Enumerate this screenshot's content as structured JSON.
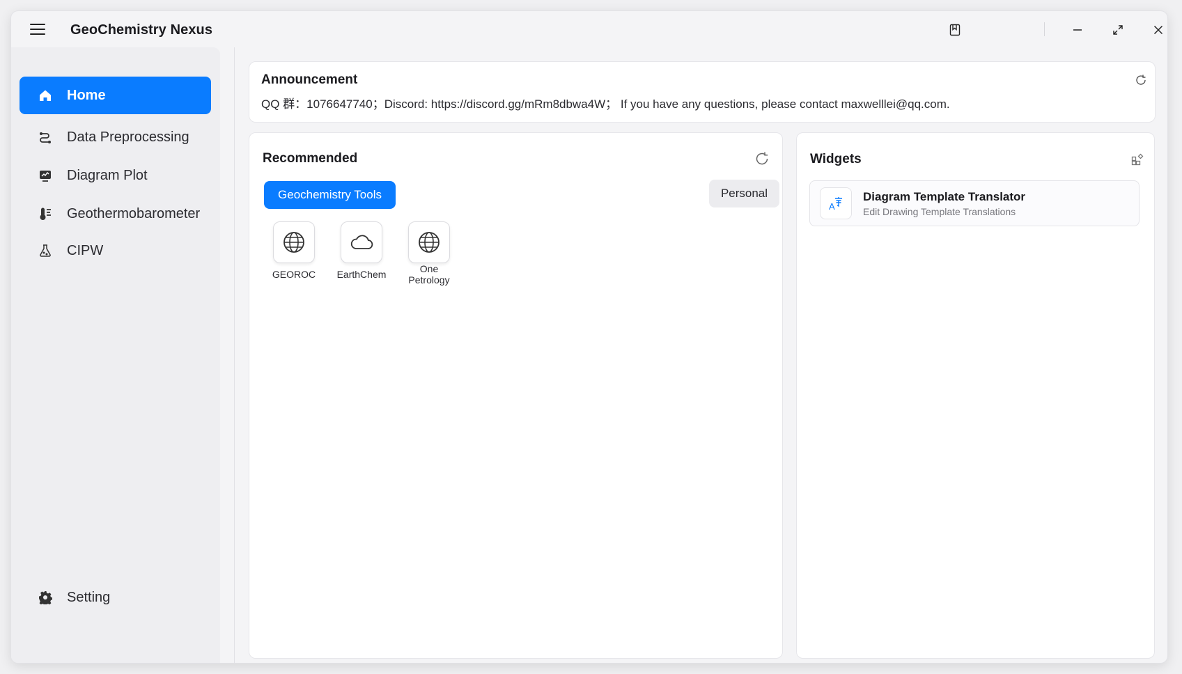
{
  "app": {
    "title": "GeoChemistry Nexus"
  },
  "window_controls": [
    "bookmark-icon",
    "minimize-icon",
    "maximize-icon",
    "close-icon"
  ],
  "sidebar": {
    "items": [
      {
        "label": "Home",
        "icon": "home-icon",
        "active": true
      },
      {
        "label": "Data Preprocessing",
        "icon": "data-preprocessing-icon",
        "active": false
      },
      {
        "label": "Diagram Plot",
        "icon": "diagram-plot-icon",
        "active": false
      },
      {
        "label": "Geothermobarometer",
        "icon": "thermometer-icon",
        "active": false
      },
      {
        "label": "CIPW",
        "icon": "cipw-icon",
        "active": false
      }
    ],
    "settings_label": "Setting"
  },
  "announcement": {
    "title": "Announcement",
    "text": "QQ 群：1076647740；Discord: https://discord.gg/mRm8dbwa4W； If you have any questions, please contact maxwelllei@qq.com."
  },
  "recommended": {
    "title": "Recommended",
    "tabs": [
      {
        "label": "Geochemistry Tools",
        "active": true
      },
      {
        "label": "Personal",
        "active": false
      }
    ],
    "tools": [
      {
        "label": "GEOROC",
        "icon": "globe-icon"
      },
      {
        "label": "EarthChem",
        "icon": "cloud-icon"
      },
      {
        "label": "One Petrology",
        "icon": "globe-icon"
      }
    ]
  },
  "widgets": {
    "title": "Widgets",
    "items": [
      {
        "title": "Diagram Template Translator",
        "subtitle": "Edit Drawing Template Translations",
        "icon": "translate-icon"
      }
    ]
  },
  "colors": {
    "accent": "#0a7cff",
    "background": "#f4f4f6",
    "card": "#ffffff"
  }
}
